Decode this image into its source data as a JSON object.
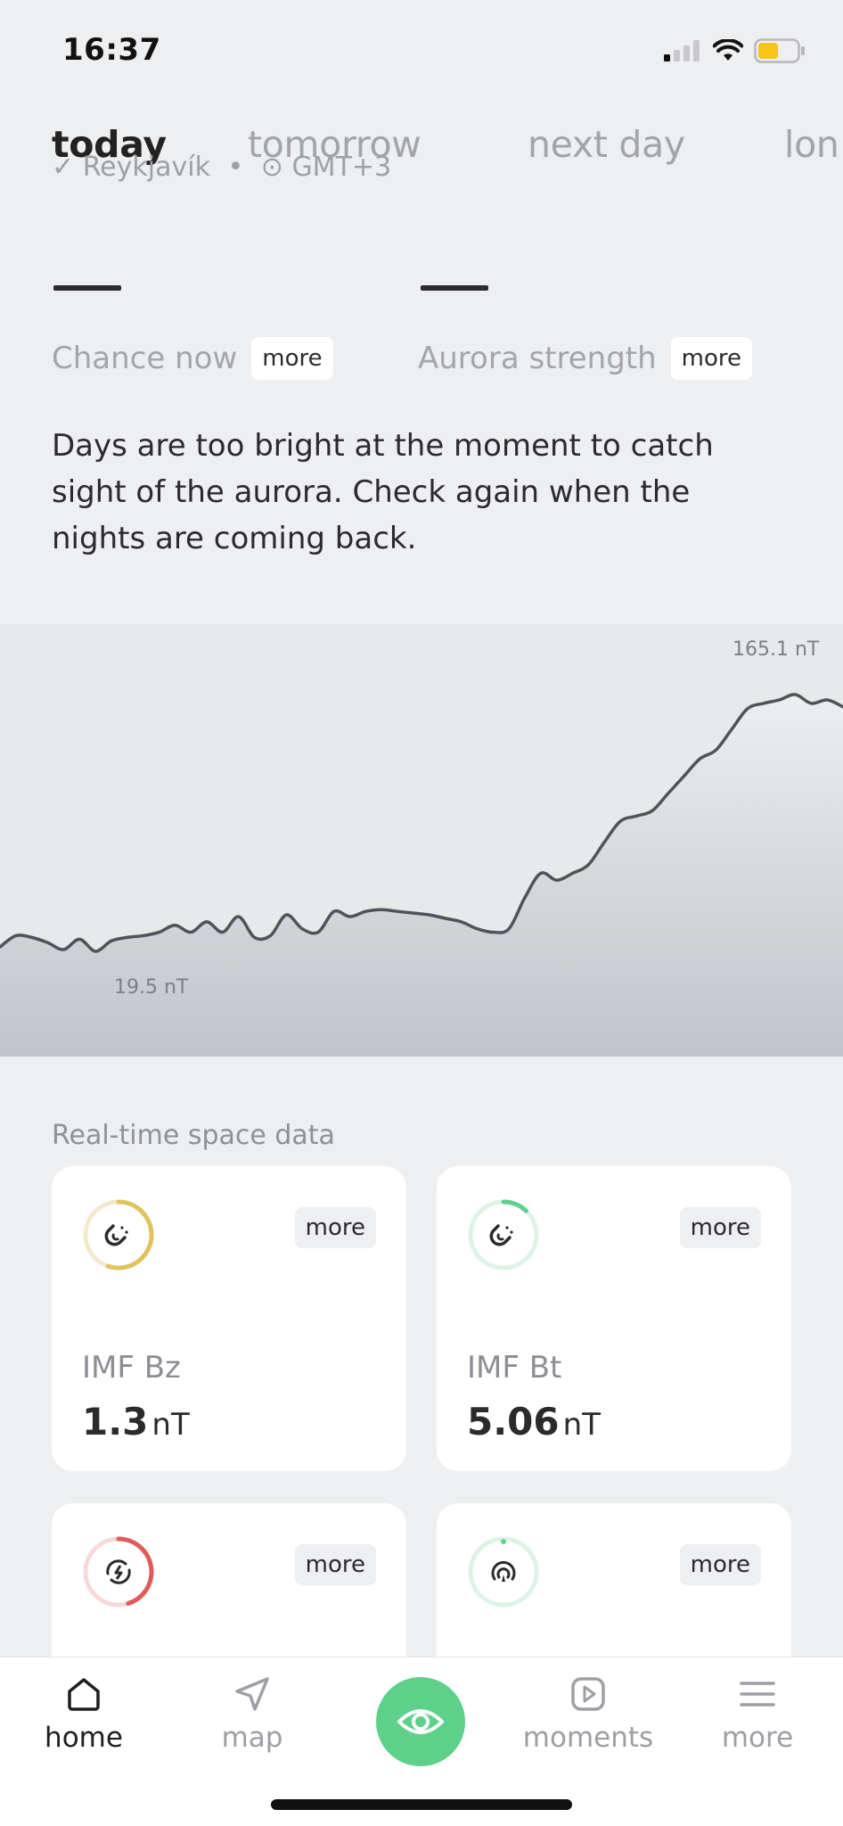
{
  "status_bar": {
    "time": "16:37"
  },
  "tabs": [
    {
      "label": "today",
      "active": true
    },
    {
      "label": "tomorrow",
      "active": false
    },
    {
      "label": "next day",
      "active": false
    },
    {
      "label": "lon",
      "active": false
    }
  ],
  "location": {
    "city": "Reykjavík",
    "timezone": "GMT+3",
    "separator": "•"
  },
  "stats": {
    "chance": {
      "value": "—",
      "label": "Chance now",
      "more": "more"
    },
    "strength": {
      "value": "—",
      "label": "Aurora strength",
      "more": "more"
    }
  },
  "message": "Days are too bright at the moment to catch sight of the aurora. Check again when the nights are coming back.",
  "chart_data": {
    "type": "area",
    "unit": "nT",
    "max_label": "165.1 nT",
    "min_label": "19.5 nT",
    "values": [
      19.5,
      26,
      25,
      22,
      18,
      24,
      17,
      23,
      25,
      26,
      28,
      32,
      28,
      34,
      28,
      37,
      25,
      26,
      38,
      30,
      28,
      40,
      37,
      40,
      41,
      40,
      39,
      38,
      36,
      34,
      30,
      28,
      30,
      48,
      62,
      58,
      62,
      67,
      80,
      92,
      95,
      98,
      108,
      118,
      128,
      133,
      145,
      157,
      160,
      162,
      165.1,
      160,
      162,
      158
    ],
    "ylim": [
      0,
      180
    ],
    "colors": {
      "line": "#4f535a",
      "fill_top": "#eceef0",
      "fill_bottom": "#c1c4c9"
    }
  },
  "space_data": {
    "title": "Real-time space data",
    "cards": [
      {
        "name": "IMF Bz",
        "value": "1.3",
        "unit": "nT",
        "more": "more",
        "icon": "magnet-icon",
        "ring_color": "#e2c25c",
        "ring_fraction": 0.55
      },
      {
        "name": "IMF Bt",
        "value": "5.06",
        "unit": "nT",
        "more": "more",
        "icon": "magnet-icon",
        "ring_color": "#62d08f",
        "ring_fraction": 0.12
      },
      {
        "name": "",
        "value": "",
        "unit": "",
        "more": "more",
        "icon": "solar-wind-icon",
        "ring_color": "#e05a5a",
        "ring_fraction": 0.45
      },
      {
        "name": "",
        "value": "",
        "unit": "",
        "more": "more",
        "icon": "signal-icon",
        "ring_color": "#62d08f",
        "ring_fraction": 0.0
      }
    ]
  },
  "nav": [
    {
      "label": "home",
      "icon": "home-icon",
      "active": true
    },
    {
      "label": "map",
      "icon": "navigation-arrow-icon",
      "active": false
    },
    {
      "label": "",
      "icon": "eye-icon",
      "active": false
    },
    {
      "label": "moments",
      "icon": "play-icon",
      "active": false
    },
    {
      "label": "more",
      "icon": "menu-icon",
      "active": false
    }
  ]
}
